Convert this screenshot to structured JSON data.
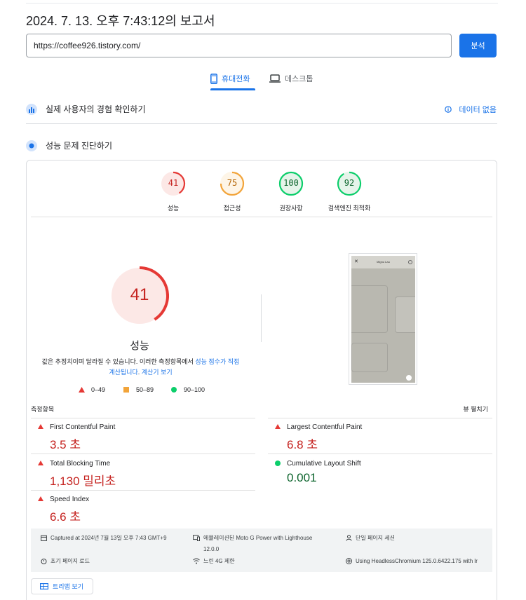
{
  "report_title": "2024. 7. 13. 오후 7:43:12의 보고서",
  "url_value": "https://coffee926.tistory.com/",
  "analyze_label": "분석",
  "tabs": {
    "mobile": "휴대전화",
    "desktop": "데스크톱"
  },
  "sections": {
    "real_user": "실제 사용자의 경험 확인하기",
    "no_data": "데이터 없음",
    "diagnose": "성능 문제 진단하기"
  },
  "gauges": [
    {
      "score": "41",
      "label": "성능",
      "color": "#e53935",
      "level": 0.41
    },
    {
      "score": "75",
      "label": "접근성",
      "color": "#f2a43a",
      "level": 0.75
    },
    {
      "score": "100",
      "label": "권장사항",
      "color": "#0cce6b",
      "level": 1.0
    },
    {
      "score": "92",
      "label": "검색엔진 최적화",
      "color": "#0cce6b",
      "level": 0.92
    }
  ],
  "main": {
    "score": "41",
    "label": "성능",
    "desc_prefix": "값은 추정치이며 달라질 수 있습니다. 이러한 측정항목에서 ",
    "desc_link": "성능 점수가 직접 계산됩니다",
    "desc_mid": ". ",
    "desc_link2": "계산기 보기"
  },
  "legend": {
    "red": "0–49",
    "orange": "50–89",
    "green": "90–100"
  },
  "phone_title": "Mignu Lau",
  "metrics_header": "측정항목",
  "expand_label": "뷰 펼치기",
  "metrics": [
    {
      "name": "First Contentful Paint",
      "value": "3.5 초"
    },
    {
      "name": "Largest Contentful Paint",
      "value": "6.8 초"
    },
    {
      "name": "Total Blocking Time",
      "value": "1,130 밀리초"
    },
    {
      "name": "Cumulative Layout Shift",
      "value": "0.001"
    },
    {
      "name": "Speed Index",
      "value": "6.6 초"
    }
  ],
  "info": {
    "captured": "Captured at 2024년 7월 13일 오후 7:43 GMT+9",
    "emulated": "에뮬레이션된 Moto G Power with Lighthouse",
    "emulated2": "12.0.0",
    "session": "단일 페이지 세션",
    "load": "초기 페이지 로드",
    "throttle": "느린 4G 제한",
    "browser": "Using HeadlessChromium 125.0.6422.175 with lr"
  },
  "treemap_label": "트리맵 보기",
  "colors": {
    "accent": "#1a73e8",
    "fail": "#c5221f",
    "pass": "#0d652d"
  }
}
